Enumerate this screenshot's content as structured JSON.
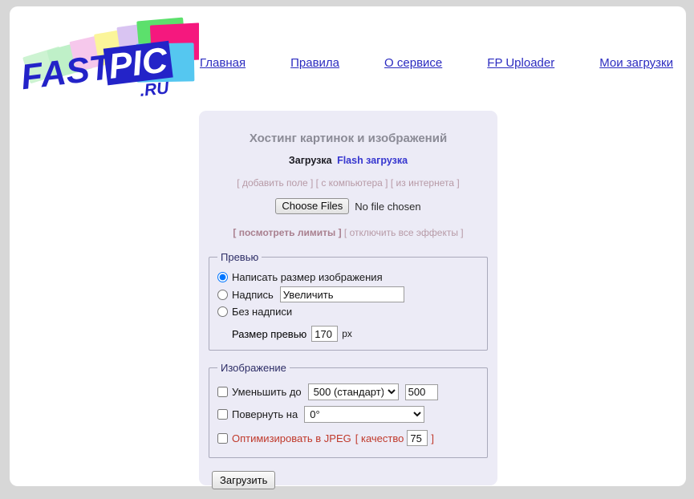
{
  "site": {
    "logo_main": "FASTPIC",
    "logo_fast": "FAST",
    "logo_pic": "PIC",
    "logo_tld": ".RU"
  },
  "nav": {
    "items": [
      {
        "label": "Главная",
        "name": "nav-home"
      },
      {
        "label": "Правила",
        "name": "nav-rules"
      },
      {
        "label": "О сервисе",
        "name": "nav-about"
      },
      {
        "label": "FP Uploader",
        "name": "nav-uploader"
      },
      {
        "label": "Мои загрузки",
        "name": "nav-my-uploads"
      }
    ]
  },
  "panel": {
    "title": "Хостинг картинок и изображений",
    "mode_current": "Загрузка",
    "mode_flash": "Flash загрузка",
    "sources": [
      "[ добавить поле ]",
      "[ с компьютера ]",
      "[ из интернета ]"
    ],
    "file_button": "Choose Files",
    "file_status": "No file chosen",
    "limits_link": "[ посмотреть лимиты ]",
    "effects_link": "[ отключить все эффекты ]",
    "submit_label": "Загрузить"
  },
  "preview": {
    "legend": "Превью",
    "opt_write_size": "Написать размер изображения",
    "opt_caption": "Надпись",
    "caption_value": "Увеличить",
    "opt_no_caption": "Без надписи",
    "size_label": "Размер превью",
    "size_value": "170",
    "size_unit": "px",
    "selected": "write_size"
  },
  "image": {
    "legend": "Изображение",
    "resize_label": "Уменьшить до",
    "resize_selected": "500 (стандарт)",
    "resize_options": [
      "500 (стандарт)"
    ],
    "resize_width": "500",
    "rotate_label": "Повернуть на",
    "rotate_selected": "0°",
    "rotate_options": [
      "0°"
    ],
    "jpeg_label": "Оптимизировать в JPEG",
    "jpeg_bracket_open": "[ качество",
    "jpeg_quality": "75",
    "jpeg_bracket_close": "]",
    "resize_checked": false,
    "rotate_checked": false,
    "jpeg_checked": false
  },
  "colors": {
    "page_background": "#d7d7d7",
    "content_background": "#ffffff",
    "panel_background": "#ecebf6",
    "link": "#2b2bc0",
    "title_gray": "#8b8b96",
    "muted_pink": "#b79aa6",
    "jpeg_red": "#c0392b",
    "legend_navy": "#2d2d66"
  }
}
